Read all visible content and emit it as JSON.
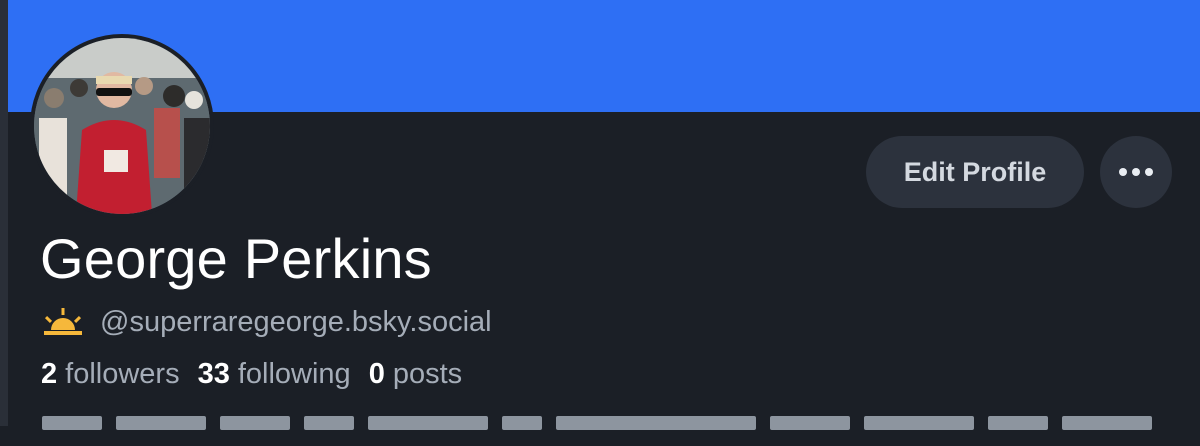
{
  "colors": {
    "banner": "#2e6ff4",
    "background": "#1b1f26",
    "button_bg": "#2c323d",
    "muted_text": "#a5adb8"
  },
  "profile": {
    "display_name": "George Perkins",
    "handle": "@superraregeorge.bsky.social",
    "handle_icon": "sunrise-icon",
    "avatar": "profile-photo"
  },
  "actions": {
    "edit_label": "Edit Profile",
    "more_icon": "more-options-icon"
  },
  "stats": [
    {
      "count": "2",
      "label": "followers"
    },
    {
      "count": "33",
      "label": "following"
    },
    {
      "count": "0",
      "label": "posts"
    }
  ]
}
